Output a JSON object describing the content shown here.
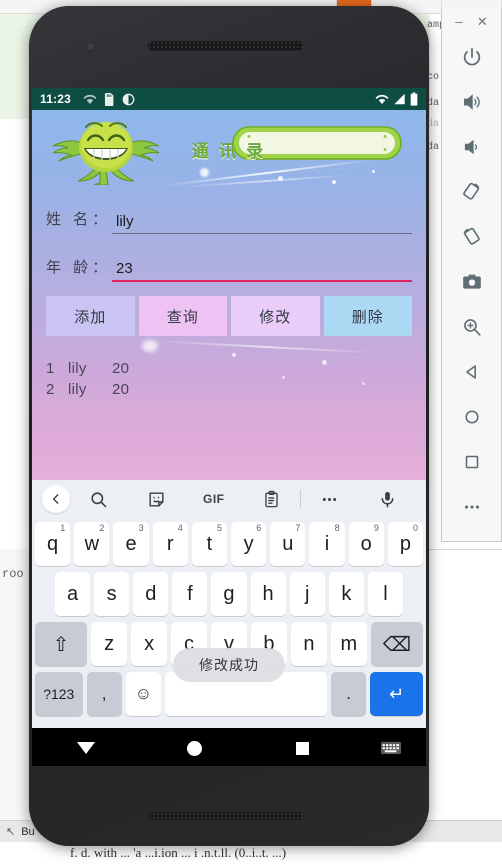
{
  "background_ide": {
    "code_fragments": [
      "amp",
      "co",
      "da",
      "da",
      "da"
    ],
    "left_fragment": "roo",
    "build_label": "Bu",
    "bottom_text": "f. d. with ... 'a ...i.ion ... i .n.t.ll. (0..i..t. ...)"
  },
  "emulator_sidebar": {
    "minimize_label": "–",
    "close_label": "✕",
    "buttons": [
      {
        "name": "power",
        "label": "Power"
      },
      {
        "name": "volume-up",
        "label": "Volume Up"
      },
      {
        "name": "volume-down",
        "label": "Volume Down"
      },
      {
        "name": "rotate-left",
        "label": "Rotate Left"
      },
      {
        "name": "rotate-right",
        "label": "Rotate Right"
      },
      {
        "name": "screenshot",
        "label": "Take Screenshot"
      },
      {
        "name": "zoom",
        "label": "Zoom Mode"
      },
      {
        "name": "back",
        "label": "Back"
      },
      {
        "name": "home",
        "label": "Home"
      },
      {
        "name": "overview",
        "label": "Overview"
      },
      {
        "name": "more",
        "label": "More"
      }
    ]
  },
  "phone": {
    "statusbar": {
      "time": "11:23",
      "left_icons": [
        "wifi-question-icon",
        "sd-card-icon",
        "adb-icon"
      ],
      "right_icons": [
        "wifi-off-icon",
        "signal-icon",
        "battery-icon"
      ],
      "background_color": "#0e4d42"
    },
    "app": {
      "title": "通 讯 录",
      "mascot": "green-frog-mascot",
      "fields": [
        {
          "label": "姓 名：",
          "value": "lily",
          "underline_color": "#6a6d88"
        },
        {
          "label": "年 龄：",
          "value": "23",
          "underline_color": "#e0245e"
        }
      ],
      "buttons": [
        {
          "label": "添加",
          "color": "#c9c4f2"
        },
        {
          "label": "查询",
          "color": "#eec3f3"
        },
        {
          "label": "修改",
          "color": "#e9ccf7"
        },
        {
          "label": "删除",
          "color": "#aed9f5"
        }
      ],
      "records": [
        {
          "id": "1",
          "name": "lily",
          "age": "20"
        },
        {
          "id": "2",
          "name": "lily",
          "age": "20"
        }
      ]
    },
    "toast": "修改成功",
    "keyboard": {
      "toolbar": [
        "back-chevron-icon",
        "search-icon",
        "sticker-icon",
        "GIF",
        "clipboard-icon",
        "more-icon",
        "mic-icon"
      ],
      "gif_label": "GIF",
      "row1": [
        {
          "key": "q",
          "num": "1"
        },
        {
          "key": "w",
          "num": "2"
        },
        {
          "key": "e",
          "num": "3"
        },
        {
          "key": "r",
          "num": "4"
        },
        {
          "key": "t",
          "num": "5"
        },
        {
          "key": "y",
          "num": "6"
        },
        {
          "key": "u",
          "num": "7"
        },
        {
          "key": "i",
          "num": "8"
        },
        {
          "key": "o",
          "num": "9"
        },
        {
          "key": "p",
          "num": "0"
        }
      ],
      "row2": [
        "a",
        "s",
        "d",
        "f",
        "g",
        "h",
        "j",
        "k",
        "l"
      ],
      "row3": [
        "z",
        "x",
        "c",
        "v",
        "b",
        "n",
        "m"
      ],
      "shift_label": "⇧",
      "backspace_label": "⌫",
      "sym_label": "?123",
      "comma_label": ",",
      "emoji_label": "☺",
      "space_label": "",
      "period_label": ".",
      "enter_label": "↵"
    },
    "navbar": {
      "back_icon": "triangle-down-icon",
      "home_icon": "circle-icon",
      "recents_icon": "square-icon",
      "keyboard_icon": "keyboard-icon"
    }
  }
}
